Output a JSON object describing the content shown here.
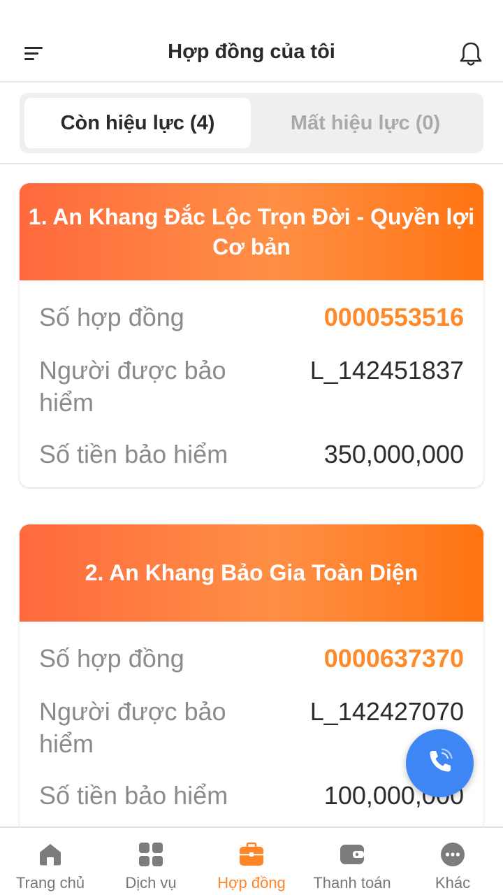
{
  "header": {
    "title": "Hợp đồng của tôi",
    "menu_icon": "menu-icon",
    "notification_icon": "bell-icon"
  },
  "tabs": [
    {
      "label": "Còn hiệu lực (4)",
      "active": true
    },
    {
      "label": "Mất hiệu lực (0)",
      "active": false
    }
  ],
  "contracts": [
    {
      "title": "1. An Khang Đắc Lộc Trọn Đời - Quyền lợi Cơ bản",
      "number_label": "Số hợp đồng",
      "number": "0000553516",
      "insured_label": "Người được bảo hiểm",
      "insured": "L_142451837",
      "amount_label": "Số tiền bảo hiểm",
      "amount": "350,000,000"
    },
    {
      "title": "2. An Khang Bảo Gia Toàn Diện",
      "number_label": "Số hợp đồng",
      "number": "0000637370",
      "insured_label": "Người được bảo hiểm",
      "insured": "L_142427070",
      "amount_label": "Số tiền bảo hiểm",
      "amount": "100,000,000"
    }
  ],
  "fab": {
    "icon": "phone-call-icon"
  },
  "bottom_nav": [
    {
      "label": "Trang chủ",
      "icon": "home-icon",
      "active": false
    },
    {
      "label": "Dịch vụ",
      "icon": "grid-icon",
      "active": false
    },
    {
      "label": "Hợp đồng",
      "icon": "briefcase-icon",
      "active": true
    },
    {
      "label": "Thanh toán",
      "icon": "wallet-icon",
      "active": false
    },
    {
      "label": "Khác",
      "icon": "more-icon",
      "active": false
    }
  ],
  "colors": {
    "accent": "#ff8427",
    "card_gradient_start": "#ff6a3d",
    "card_gradient_end": "#ff7412",
    "fab": "#3f86f5",
    "inactive": "#a9a9a9"
  }
}
